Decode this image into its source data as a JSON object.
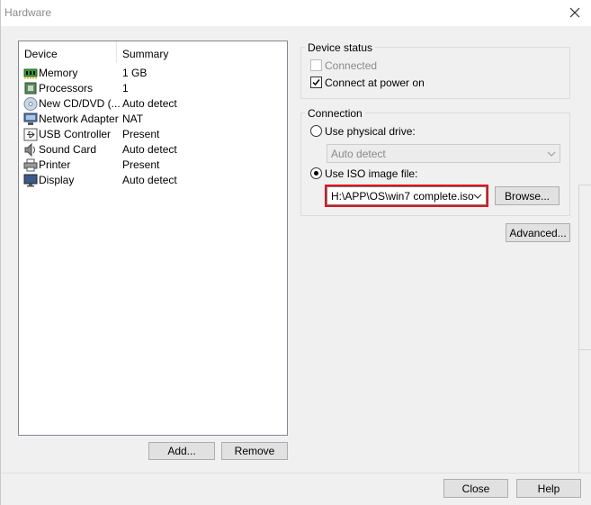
{
  "window": {
    "title": "Hardware"
  },
  "device_list": {
    "columns": [
      "Device",
      "Summary"
    ],
    "rows": [
      {
        "icon": "memory-icon",
        "device": "Memory",
        "summary": "1 GB"
      },
      {
        "icon": "processor-icon",
        "device": "Processors",
        "summary": "1"
      },
      {
        "icon": "cd-dvd-icon",
        "device": "New CD/DVD (...",
        "summary": "Auto detect"
      },
      {
        "icon": "network-adapter-icon",
        "device": "Network Adapter",
        "summary": "NAT"
      },
      {
        "icon": "usb-icon",
        "device": "USB Controller",
        "summary": "Present"
      },
      {
        "icon": "sound-card-icon",
        "device": "Sound Card",
        "summary": "Auto detect"
      },
      {
        "icon": "printer-icon",
        "device": "Printer",
        "summary": "Present"
      },
      {
        "icon": "display-icon",
        "device": "Display",
        "summary": "Auto detect"
      }
    ],
    "add_label": "Add...",
    "remove_label": "Remove"
  },
  "device_status": {
    "label": "Device status",
    "connected_label": "Connected",
    "connected_checked": false,
    "connect_power_label": "Connect at power on",
    "connect_power_checked": true
  },
  "connection": {
    "label": "Connection",
    "physical_label": "Use physical drive:",
    "physical_value": "Auto detect",
    "iso_label": "Use ISO image file:",
    "iso_value": "H:\\APP\\OS\\win7 complete.iso",
    "selected_option": "iso",
    "browse_label": "Browse..."
  },
  "advanced_label": "Advanced...",
  "footer": {
    "close_label": "Close",
    "help_label": "Help"
  },
  "colors": {
    "highlight": "#e0141e",
    "panel_bg": "#f0f0f0",
    "button_bg": "#e1e1e1"
  }
}
